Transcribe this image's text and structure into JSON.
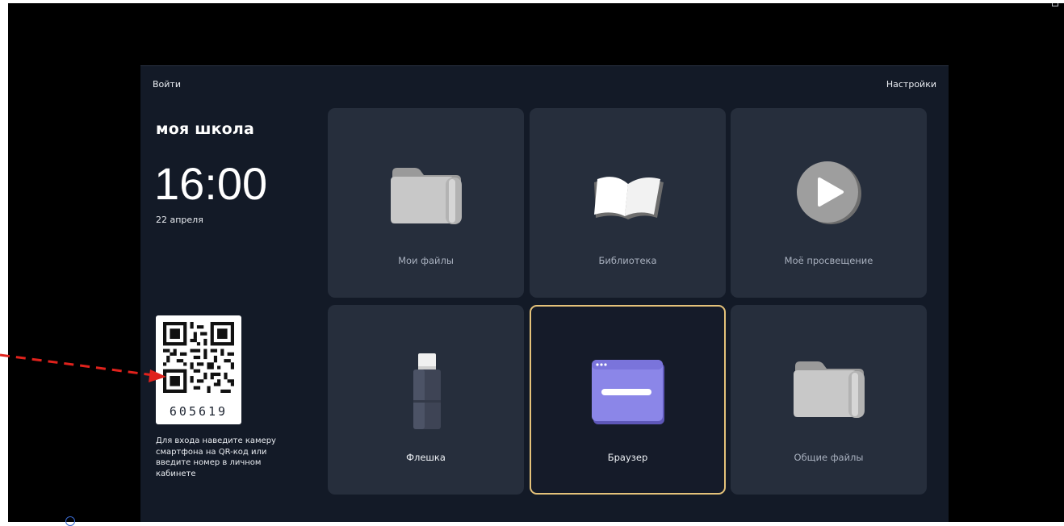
{
  "header": {
    "login_label": "Войти",
    "settings_label": "Настройки"
  },
  "brand": "моя школа",
  "clock": {
    "time": "16:00",
    "date": "22 апреля"
  },
  "qr": {
    "code": "605619",
    "hint": "Для входа наведите камеру смартфона на QR-код или введите номер в личном кабинете"
  },
  "tiles": [
    {
      "label": "Мои файлы",
      "icon": "folder-icon"
    },
    {
      "label": "Библиотека",
      "icon": "book-icon"
    },
    {
      "label": "Моё просвещение",
      "icon": "play-icon"
    },
    {
      "label": "Флешка",
      "icon": "usb-drive-icon"
    },
    {
      "label": "Браузер",
      "icon": "browser-window-icon",
      "selected": true
    },
    {
      "label": "Общие файлы",
      "icon": "folder-icon"
    }
  ],
  "colors": {
    "background": "#000000",
    "panel": "#131a27",
    "tile": "#262e3c",
    "selected_border": "#e4c27a",
    "annotation_arrow": "#e0221c",
    "browser_icon": "#8b86e8"
  }
}
